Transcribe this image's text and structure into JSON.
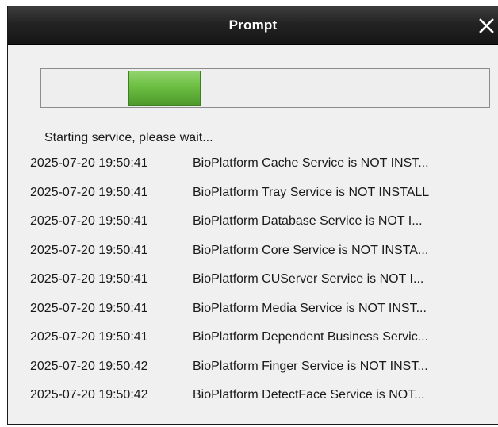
{
  "window": {
    "title": "Prompt",
    "close_label": "✕"
  },
  "progress": {
    "indeterminate": true,
    "fill_color": "#6cbf42"
  },
  "status_text": "Starting service, please wait...",
  "log": [
    {
      "time": "2025-07-20 19:50:41",
      "message": "BioPlatform Cache Service is NOT INST..."
    },
    {
      "time": "2025-07-20 19:50:41",
      "message": "BioPlatform Tray Service is NOT INSTALL"
    },
    {
      "time": "2025-07-20 19:50:41",
      "message": "BioPlatform Database Service is NOT I..."
    },
    {
      "time": "2025-07-20 19:50:41",
      "message": "BioPlatform Core Service is NOT INSTA..."
    },
    {
      "time": "2025-07-20 19:50:41",
      "message": "BioPlatform CUServer Service is NOT I..."
    },
    {
      "time": "2025-07-20 19:50:41",
      "message": "BioPlatform Media Service is NOT INST..."
    },
    {
      "time": "2025-07-20 19:50:41",
      "message": "BioPlatform Dependent Business Servic..."
    },
    {
      "time": "2025-07-20 19:50:42",
      "message": "BioPlatform Finger Service is NOT INST..."
    },
    {
      "time": "2025-07-20 19:50:42",
      "message": "BioPlatform DetectFace Service is NOT..."
    }
  ]
}
